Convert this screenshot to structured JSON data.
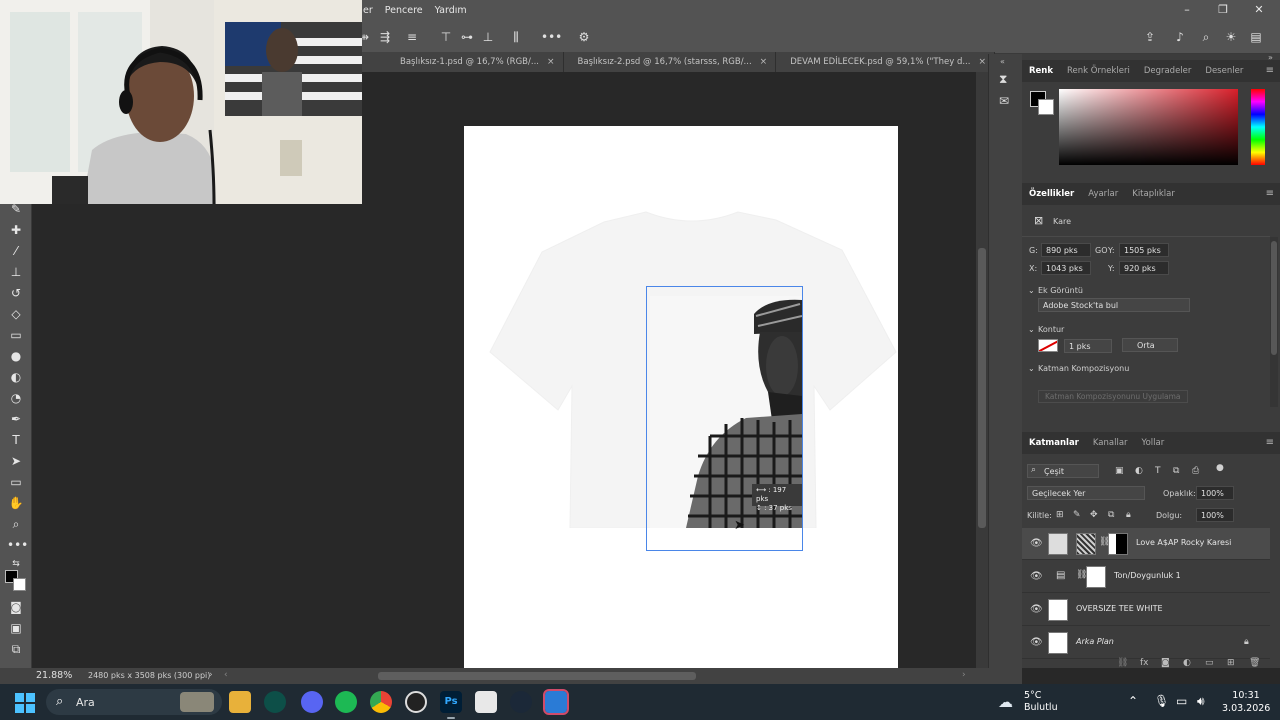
{
  "menubar": {
    "items": [
      "er",
      "Pencere",
      "Yardım"
    ],
    "controls": {
      "minimize": "minimize-icon",
      "restore": "restore-icon",
      "close": "close-icon"
    }
  },
  "tabs": [
    {
      "label": "Başlıksız-1.psd @ 16,7% (RGB/...",
      "close": "×"
    },
    {
      "label": "Başlıksız-2.psd @ 16,7% (starsss, RGB/...",
      "close": "×"
    },
    {
      "label": "DEVAM EDİLECEK.psd @ 59,1% (\"They d...",
      "close": "×"
    }
  ],
  "canvas": {
    "tooltip_w": "⟷ : 197 pks",
    "tooltip_h": "↕ :  37 pks"
  },
  "color_panel": {
    "tabs": [
      "Renk",
      "Renk Örnekleri",
      "Degradeler",
      "Desenler"
    ],
    "active_tab": "Renk",
    "foreground": "#000000",
    "background": "#ffffff"
  },
  "properties_panel": {
    "tabs": [
      "Özellikler",
      "Ayarlar",
      "Kitaplıklar"
    ],
    "active_tab": "Özellikler",
    "shape_label": "Kare",
    "w_label": "G:",
    "w_value": "890 pks",
    "link_label": "GO",
    "h_label": "Y:",
    "h_value": "1505 pks",
    "x_label": "X:",
    "x_value": "1043 pks",
    "y_label": "Y:",
    "y_value": "920 pks",
    "section_extra": "Ek Görüntü",
    "stock_dropdown": "Adobe Stock'ta bul",
    "section_stroke": "Kontur",
    "stroke_width": "1 pks",
    "stroke_align": "Orta",
    "section_comp": "Katman Kompozisyonu",
    "comp_button": "Katman Kompozisyonunu Uygulama"
  },
  "layers_panel": {
    "tabs": [
      "Katmanlar",
      "Kanallar",
      "Yollar"
    ],
    "active_tab": "Katmanlar",
    "filter": "Çeşit",
    "blend_mode": "Geçilecek Yer",
    "opacity_label": "Opaklık:",
    "opacity_value": "100%",
    "lock_label": "Kilitle:",
    "fill_label": "Dolgu:",
    "fill_value": "100%",
    "layers": [
      {
        "name": "Love A$AP Rocky Karesi",
        "italic": false,
        "active": true
      },
      {
        "name": "Ton/Doygunluk 1",
        "italic": false,
        "active": false
      },
      {
        "name": "OVERSIZE TEE WHITE",
        "italic": false,
        "active": false
      },
      {
        "name": "Arka Plan",
        "italic": true,
        "active": false
      }
    ]
  },
  "statusbar": {
    "zoom": "21.88%",
    "doc_info": "2480 pks x 3508 pks (300 ppi)"
  },
  "taskbar": {
    "search_placeholder": "Ara",
    "apps": [
      "file-explorer",
      "edge-vpn",
      "discord",
      "spotify",
      "chrome",
      "obs",
      "photoshop",
      "snipping-tool",
      "steam",
      "paint"
    ],
    "photoshop_label": "Ps",
    "weather_temp": "5°C",
    "weather_desc": "Bulutlu",
    "time": "10:31",
    "date": "3.03.2026"
  }
}
